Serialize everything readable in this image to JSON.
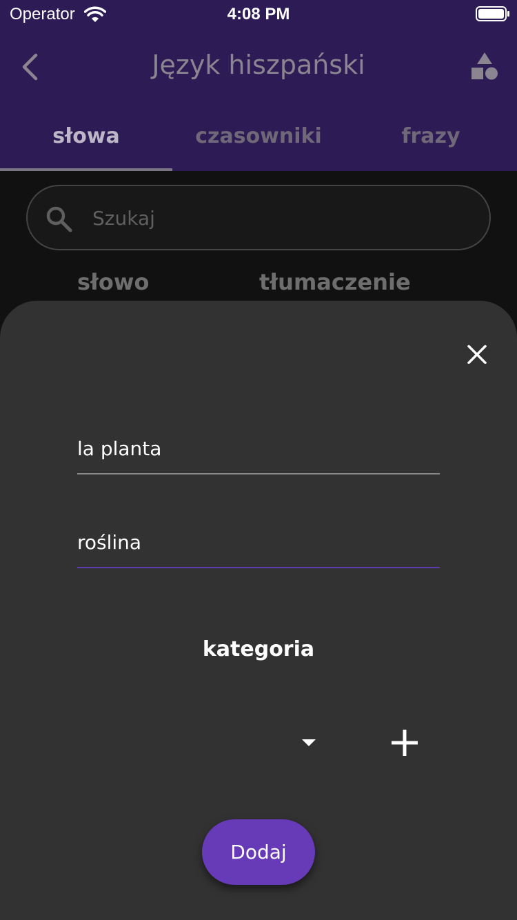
{
  "status_bar": {
    "carrier": "Operator",
    "time": "4:08 PM",
    "icons": [
      "wifi-icon",
      "battery-icon"
    ]
  },
  "app_bar": {
    "title": "Język hiszpański",
    "back_icon": "chevron-left-icon",
    "action_icon": "shapes-icon"
  },
  "tabs": [
    {
      "label": "słowa",
      "active": true
    },
    {
      "label": "czasowniki",
      "active": false
    },
    {
      "label": "frazy",
      "active": false
    }
  ],
  "search": {
    "placeholder": "Szukaj",
    "value": ""
  },
  "columns": {
    "word": "słowo",
    "translation": "tłumaczenie"
  },
  "sheet": {
    "word_value": "la planta",
    "translation_value": "roślina",
    "category_label": "kategoria",
    "category_selected": "",
    "add_button_label": "Dodaj"
  },
  "colors": {
    "header_bg": "#2d1b55",
    "sheet_bg": "#323232",
    "accent": "#673ab7",
    "focus_underline": "#5b3db0"
  }
}
